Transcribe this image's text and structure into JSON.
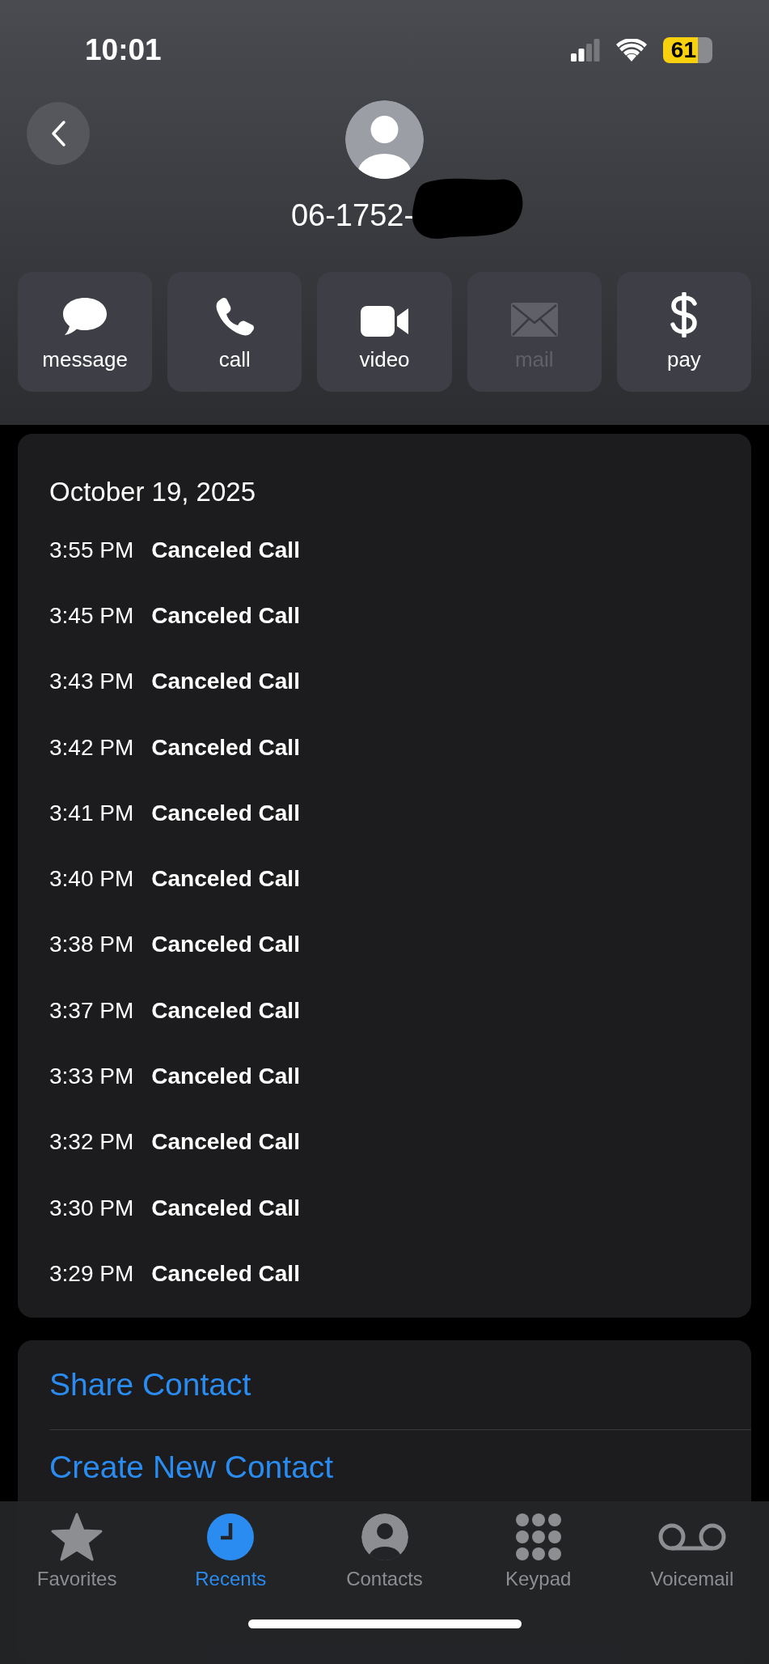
{
  "status_bar": {
    "time": "10:01",
    "battery": "61"
  },
  "contact": {
    "number": "06-1752-"
  },
  "actions": [
    {
      "label": "message",
      "kind": "message",
      "disabled": false
    },
    {
      "label": "call",
      "kind": "call",
      "disabled": false
    },
    {
      "label": "video",
      "kind": "video",
      "disabled": false
    },
    {
      "label": "mail",
      "kind": "mail",
      "disabled": true
    },
    {
      "label": "pay",
      "kind": "pay",
      "disabled": false
    }
  ],
  "call_log": {
    "date": "October 19, 2025",
    "entries": [
      {
        "time": "3:55 PM",
        "type": "Canceled Call"
      },
      {
        "time": "3:45 PM",
        "type": "Canceled Call"
      },
      {
        "time": "3:43 PM",
        "type": "Canceled Call"
      },
      {
        "time": "3:42 PM",
        "type": "Canceled Call"
      },
      {
        "time": "3:41 PM",
        "type": "Canceled Call"
      },
      {
        "time": "3:40 PM",
        "type": "Canceled Call"
      },
      {
        "time": "3:38 PM",
        "type": "Canceled Call"
      },
      {
        "time": "3:37 PM",
        "type": "Canceled Call"
      },
      {
        "time": "3:33 PM",
        "type": "Canceled Call"
      },
      {
        "time": "3:32 PM",
        "type": "Canceled Call"
      },
      {
        "time": "3:30 PM",
        "type": "Canceled Call"
      },
      {
        "time": "3:29 PM",
        "type": "Canceled Call"
      }
    ]
  },
  "contact_actions": [
    "Share Contact",
    "Create New Contact"
  ],
  "tab_bar": {
    "items": [
      {
        "label": "Favorites",
        "kind": "favorites",
        "selected": false
      },
      {
        "label": "Recents",
        "kind": "recents",
        "selected": true
      },
      {
        "label": "Contacts",
        "kind": "contacts",
        "selected": false
      },
      {
        "label": "Keypad",
        "kind": "keypad",
        "selected": false
      },
      {
        "label": "Voicemail",
        "kind": "voicemail",
        "selected": false
      }
    ]
  }
}
